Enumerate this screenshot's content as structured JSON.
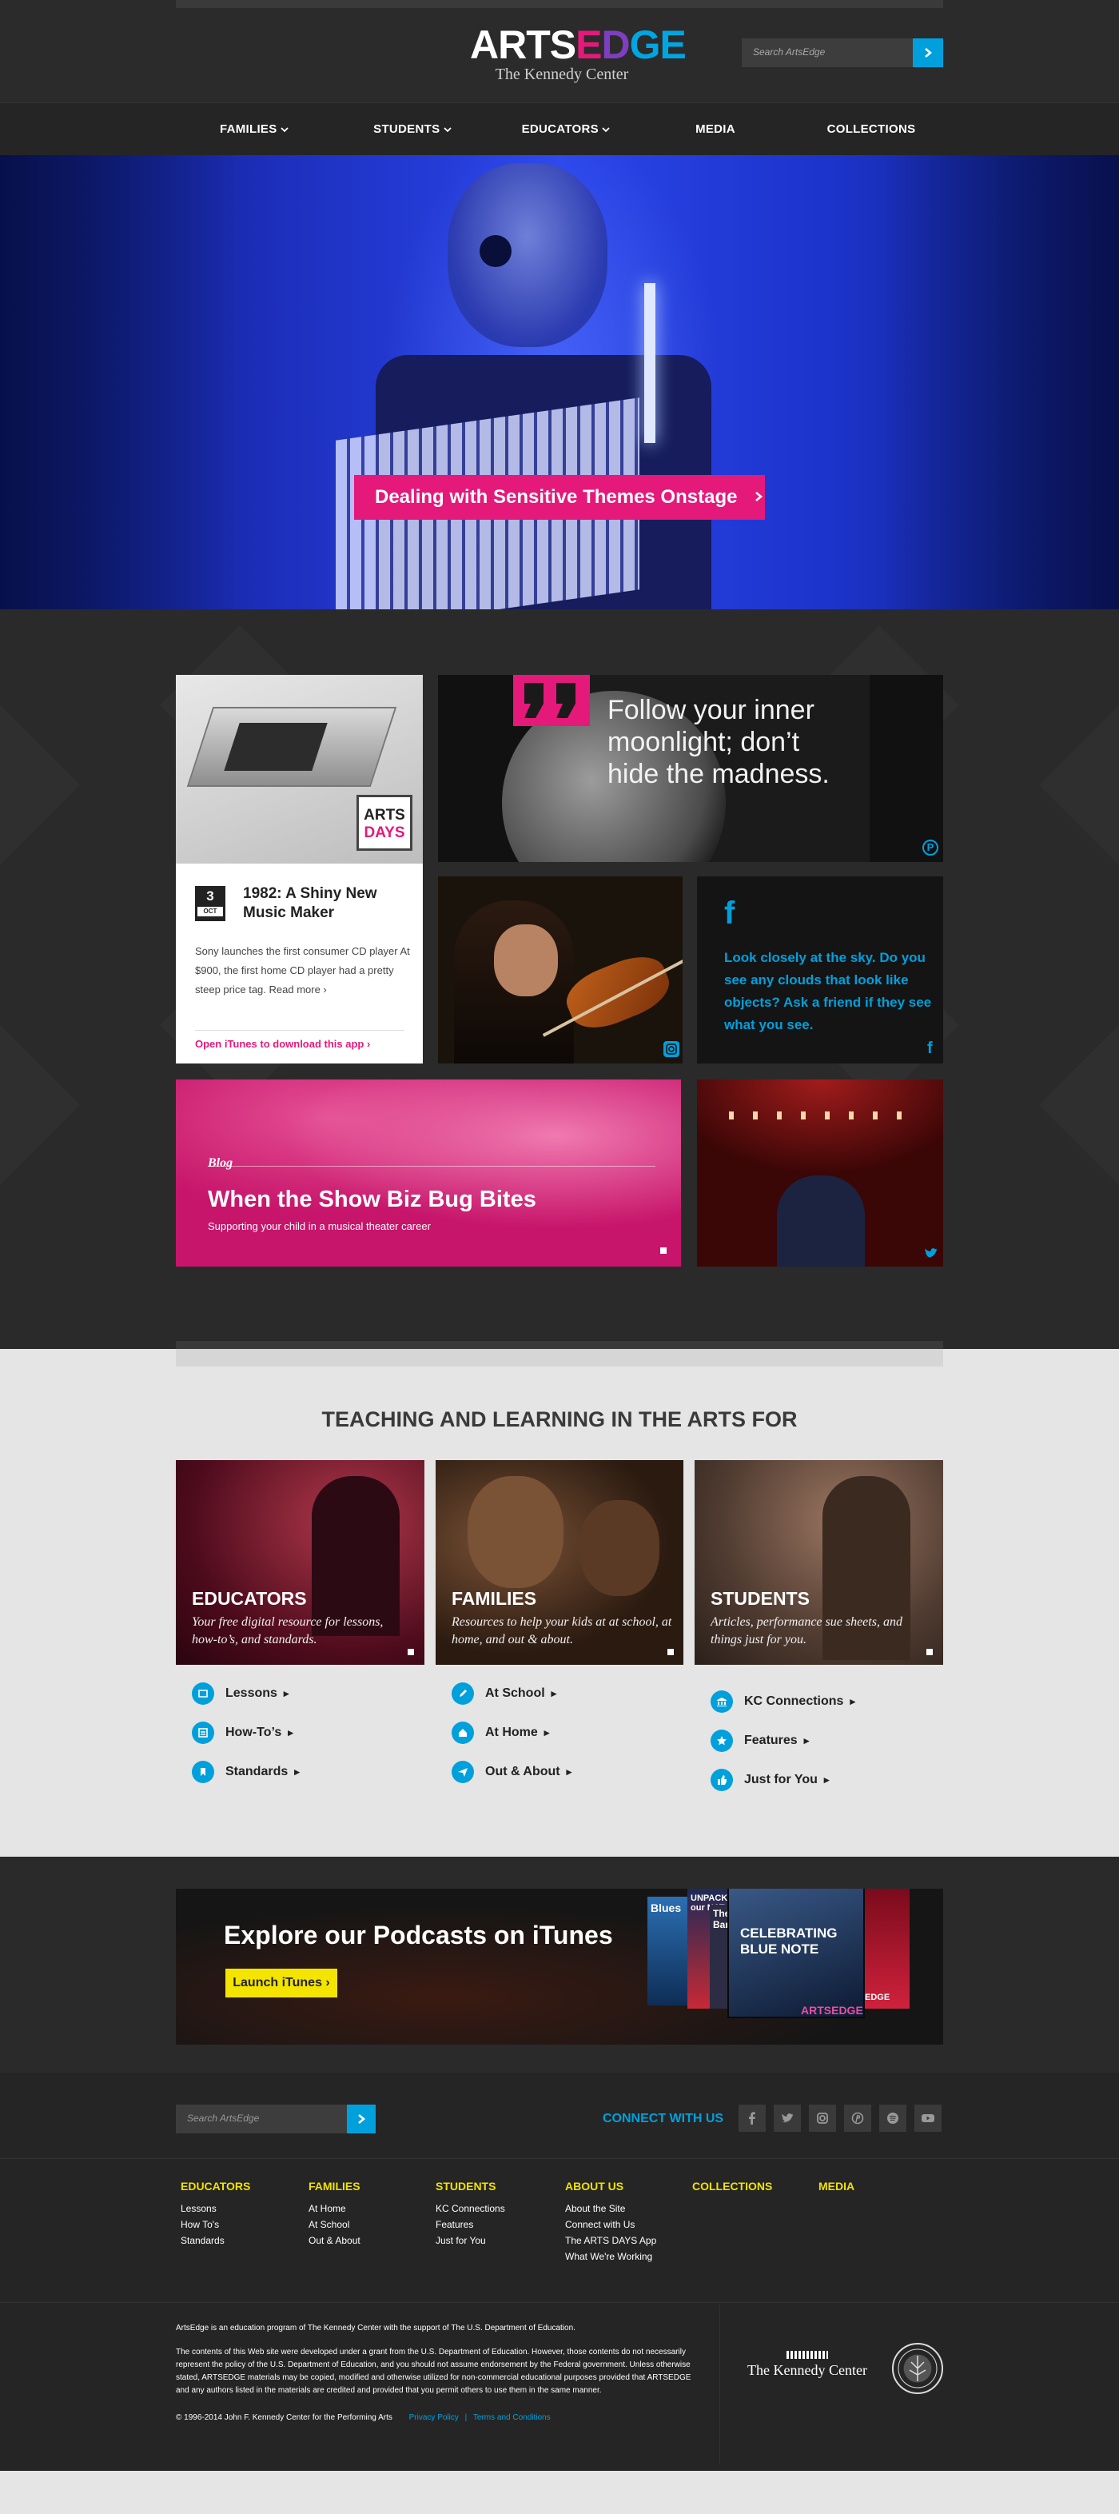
{
  "header": {
    "logo_word": "ARTSEDGE",
    "logo_parts": [
      "ARTS",
      "E",
      "D",
      "GE"
    ],
    "logo_sub": "The Kennedy Center",
    "search_placeholder": "Search ArtsEdge"
  },
  "nav": [
    "FAMILIES",
    "STUDENTS",
    "EDUCATORS",
    "MEDIA",
    "COLLECTIONS"
  ],
  "hero": {
    "cta": "Dealing with Sensitive Themes Onstage"
  },
  "tiles": {
    "artsdays": {
      "badge_line1": "ARTS",
      "badge_line2": "DAYS",
      "day": "3",
      "month": "OCT",
      "title": "1982: A Shiny New Music Maker",
      "body": "Sony launches the first consumer CD player At $900, the first home CD player had a pretty steep price tag.",
      "read_more": "Read more ›",
      "itunes": "Open iTunes to download this app ›"
    },
    "quote": {
      "text": "Follow your inner moonlight; don’t hide the madness."
    },
    "facebook": {
      "text": "Look closely at the sky. Do you see any clouds that look like objects? Ask a friend if they see what you see."
    },
    "blog": {
      "kicker": "Blog",
      "title": "When the Show Biz Bug Bites",
      "sub": "Supporting your child in a musical theater career"
    }
  },
  "teaching": {
    "title": "TEACHING AND LEARNING IN THE ARTS FOR",
    "cards": [
      {
        "title": "EDUCATORS",
        "desc": "Your free digital resource for lessons, how-to’s, and standards.",
        "links": [
          "Lessons",
          "How-To’s",
          "Standards"
        ]
      },
      {
        "title": "FAMILIES",
        "desc": "Resources to help your kids at at school, at home, and out & about.",
        "links": [
          "At School",
          "At Home",
          "Out & About"
        ]
      },
      {
        "title": "STUDENTS",
        "desc": "Articles, performance sue sheets, and things just for you.",
        "links": [
          "KC Connections",
          "Features",
          "Just for You"
        ]
      }
    ]
  },
  "podcast": {
    "title": "Explore our Podcasts on iTunes",
    "button": "Launch iTunes ›",
    "cover_title_1": "CELEBRATING",
    "cover_title_2": "BLUE NOTE",
    "cover_brand": "ARTSEDGE",
    "back_cover_a": "Blues",
    "back_cover_b": "UNPACK our NAT",
    "back_cover_c": "The Star Ban",
    "back_cover_d": "EDGE"
  },
  "footer": {
    "search_placeholder": "Search ArtsEdge",
    "connect": "CONNECT WITH US",
    "social": [
      "facebook-icon",
      "twitter-icon",
      "instagram-icon",
      "pinterest-icon",
      "spotify-icon",
      "youtube-icon"
    ],
    "columns": [
      {
        "heading": "EDUCATORS",
        "items": [
          "Lessons",
          "How To's",
          "Standards"
        ]
      },
      {
        "heading": "FAMILIES",
        "items": [
          "At Home",
          "At School",
          "Out & About"
        ]
      },
      {
        "heading": "STUDENTS",
        "items": [
          "KC Connections",
          "Features",
          "Just for You"
        ]
      },
      {
        "heading": "ABOUT US",
        "items": [
          "About the Site",
          "Connect with Us",
          "The ARTS DAYS App",
          "What We're Working"
        ]
      },
      {
        "heading": "COLLECTIONS",
        "items": []
      },
      {
        "heading": "MEDIA",
        "items": []
      }
    ],
    "legal1": "ArtsEdge is an education program of The Kennedy Center with the support of The U.S. Department of Education.",
    "legal2": "The contents of this Web site were developed under a grant from the U.S. Department of Education. However, those contents do not necessarily represent the policy of the U.S. Department of Education, and you should not assume endorsement by the Federal government. Unless otherwise stated, ARTSEDGE materials may be copied, modified and otherwise utilized for non-commercial educational purposes provided that ARTSEDGE and any authors listed in the materials are credited and provided that you permit others to use them in the same manner.",
    "copyright": "© 1996-2014 John F. Kennedy Center for the Performing Arts",
    "privacy": "Privacy Policy",
    "sep": "|",
    "terms": "Terms and Conditions",
    "kc_name": "The Kennedy Center"
  },
  "colors": {
    "accent_blue": "#00a0dc",
    "accent_pink": "#e5197a",
    "accent_yellow": "#f1e200"
  }
}
